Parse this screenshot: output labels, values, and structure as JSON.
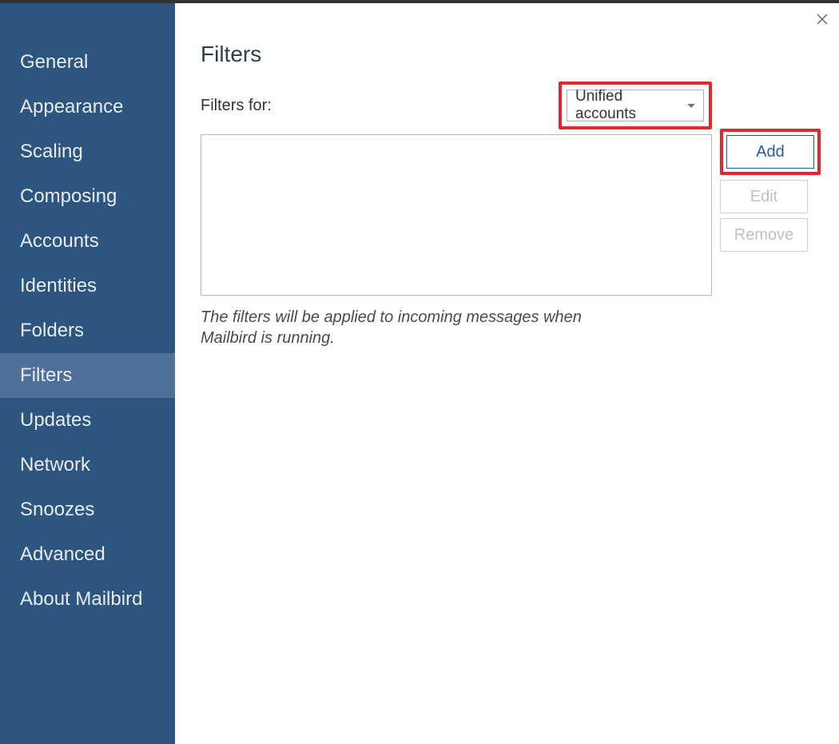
{
  "sidebar": {
    "items": [
      {
        "label": "General",
        "active": false
      },
      {
        "label": "Appearance",
        "active": false
      },
      {
        "label": "Scaling",
        "active": false
      },
      {
        "label": "Composing",
        "active": false
      },
      {
        "label": "Accounts",
        "active": false
      },
      {
        "label": "Identities",
        "active": false
      },
      {
        "label": "Folders",
        "active": false
      },
      {
        "label": "Filters",
        "active": true
      },
      {
        "label": "Updates",
        "active": false
      },
      {
        "label": "Network",
        "active": false
      },
      {
        "label": "Snoozes",
        "active": false
      },
      {
        "label": "Advanced",
        "active": false
      },
      {
        "label": "About Mailbird",
        "active": false
      }
    ]
  },
  "main": {
    "title": "Filters",
    "filters_for_label": "Filters for:",
    "dropdown_value": "Unified accounts",
    "buttons": {
      "add": "Add",
      "edit": "Edit",
      "remove": "Remove"
    },
    "info_text": "The filters will be applied to incoming messages when Mailbird is running."
  }
}
